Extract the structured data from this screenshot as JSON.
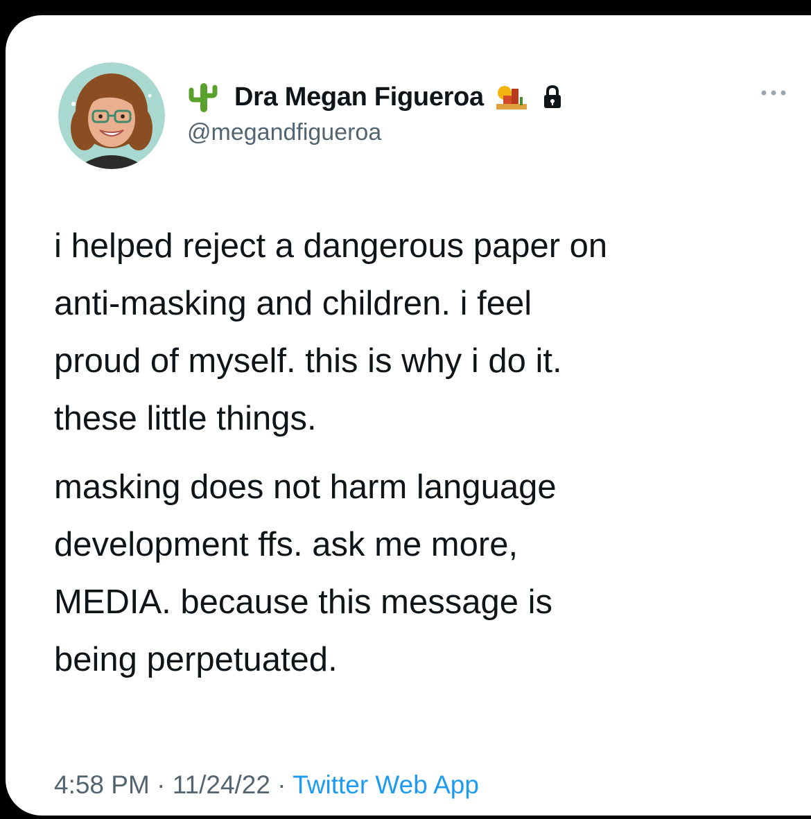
{
  "tweet": {
    "author": {
      "display_name": "Dra Megan Figueroa",
      "handle": "@megandfigueroa",
      "name_prefix_icon": "cactus-icon",
      "name_suffix_icons": [
        "desert-icon",
        "lock-icon"
      ]
    },
    "more_icon": "more-icon",
    "paragraphs": [
      "i helped reject a dangerous paper on\nanti-masking and children. i feel\nproud of myself. this is why i do it.\nthese little things.",
      "masking does not harm language\ndevelopment ffs. ask me more,\nMEDIA. because this message is\nbeing perpetuated."
    ],
    "time": "4:58 PM",
    "date": "11/24/22",
    "separator": " · ",
    "source": "Twitter Web App"
  },
  "colors": {
    "background": "#000000",
    "card": "#ffffff",
    "text_primary": "#0f1419",
    "text_secondary": "#536471",
    "link": "#1d9bf0"
  }
}
